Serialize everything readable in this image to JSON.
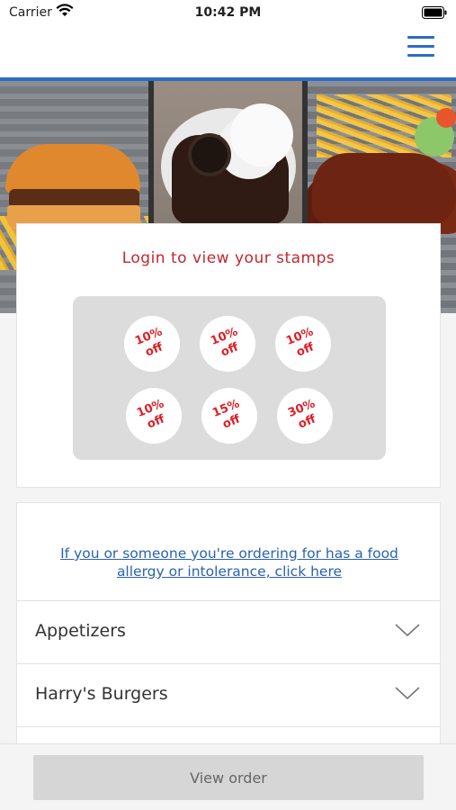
{
  "status_bar": {
    "carrier": "Carrier",
    "time": "10:42 PM"
  },
  "header": {
    "menu_icon": "hamburger-menu-icon",
    "accent_color": "#2c6cc4"
  },
  "stamp_card": {
    "title": "Login to view your stamps",
    "title_color": "#c4262e",
    "stamps": [
      {
        "label": "10%\noff"
      },
      {
        "label": "10%\noff"
      },
      {
        "label": "10%\noff"
      },
      {
        "label": "10%\noff"
      },
      {
        "label": "15%\noff"
      },
      {
        "label": "30%\noff"
      }
    ],
    "stamp_color": "#e01e26"
  },
  "menu": {
    "allergy_link": "If you or someone you're ordering for has a food allergy or intolerance, click here",
    "link_color": "#2a62b0",
    "categories": [
      {
        "label": "Appetizers"
      },
      {
        "label": "Harry's Burgers"
      }
    ]
  },
  "bottom_bar": {
    "view_order_label": "View order"
  }
}
